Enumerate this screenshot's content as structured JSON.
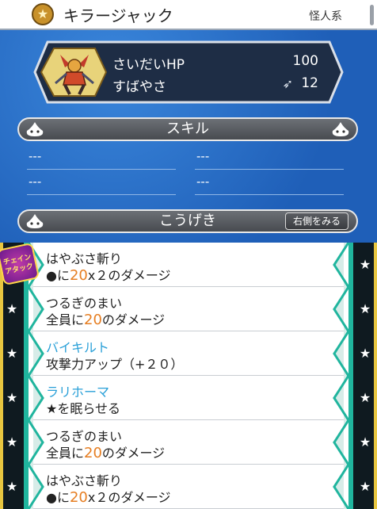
{
  "header": {
    "title": "キラージャック",
    "family": "怪人系",
    "rank_icon": "star-icon"
  },
  "stats": {
    "hp_label": "さいだいHP",
    "hp_value": "100",
    "speed_label": "すばやさ",
    "speed_value": "12",
    "speed_icon": "feather-icon"
  },
  "skills": {
    "title": "スキル",
    "slots": [
      "---",
      "---",
      "---",
      "---"
    ]
  },
  "attacks": {
    "title": "こうげき",
    "right_button": "右側をみる",
    "chain_badge": "チェイン\nアタック",
    "items": [
      {
        "name": "はやぶさ斬り",
        "desc_pre": "●に",
        "num": "20",
        "desc_post": "x２のダメージ",
        "name_color": "normal",
        "chain": true
      },
      {
        "name": "つるぎのまい",
        "desc_pre": "全員に",
        "num": "20",
        "desc_post": "のダメージ",
        "name_color": "normal",
        "chain": false
      },
      {
        "name": "バイキルト",
        "desc_pre": "攻撃力アップ（+２０）",
        "num": "",
        "desc_post": "",
        "name_color": "blue",
        "chain": false
      },
      {
        "name": "ラリホーマ",
        "desc_pre": "★を眠らせる",
        "num": "",
        "desc_post": "",
        "name_color": "blue",
        "chain": false
      },
      {
        "name": "つるぎのまい",
        "desc_pre": "全員に",
        "num": "20",
        "desc_post": "のダメージ",
        "name_color": "normal",
        "chain": false
      },
      {
        "name": "はやぶさ斬り",
        "desc_pre": "●に",
        "num": "20",
        "desc_post": "x２のダメージ",
        "name_color": "normal",
        "chain": false
      }
    ]
  },
  "colors": {
    "accent_blue": "#2aa0d8",
    "number_orange": "#e67e22",
    "teal": "#20b59e"
  }
}
